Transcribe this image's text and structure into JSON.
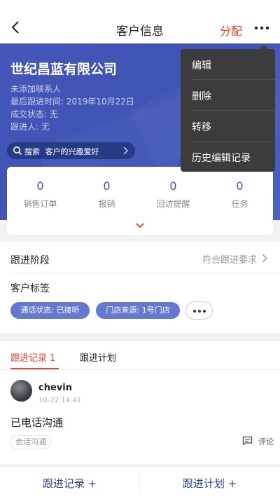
{
  "header": {
    "title": "客户信息",
    "assign_label": "分配"
  },
  "company": {
    "name": "世纪昌蓝有限公司",
    "contact": "未添加联系人",
    "last_followup": "最后跟进时间: 2019年10月22日",
    "deal_status": "成交状态: 无",
    "follower": "跟进人: 无"
  },
  "search": {
    "label": "搜索",
    "text": "客户的兴趣爱好"
  },
  "stats": [
    {
      "value": "0",
      "label": "销售订单"
    },
    {
      "value": "0",
      "label": "报销"
    },
    {
      "value": "0",
      "label": "回访提醒"
    },
    {
      "value": "0",
      "label": "任务"
    }
  ],
  "stage": {
    "label": "跟进阶段",
    "value": "符合跟进要求"
  },
  "tags": {
    "label": "客户标签",
    "items": [
      "通话状态: 已接听",
      "门店来源: 1号门店"
    ]
  },
  "records": {
    "tabs": [
      "跟进记录 1",
      "跟进计划"
    ],
    "entry": {
      "user": "chevin",
      "time": "10-22 14:41",
      "content": "已电话沟通",
      "tag": "会话沟通",
      "comment_label": "评论"
    }
  },
  "bottom": {
    "record_button": "跟进记录 +",
    "plan_button": "跟进计划 +"
  },
  "menu": {
    "items": [
      "编辑",
      "删除",
      "转移",
      "历史编辑记录"
    ]
  },
  "colors": {
    "accent": "#e8452c",
    "brand_blue": "#3e54b6",
    "tag_blue": "#6578d0",
    "menu_bg": "#3c3c3e"
  }
}
